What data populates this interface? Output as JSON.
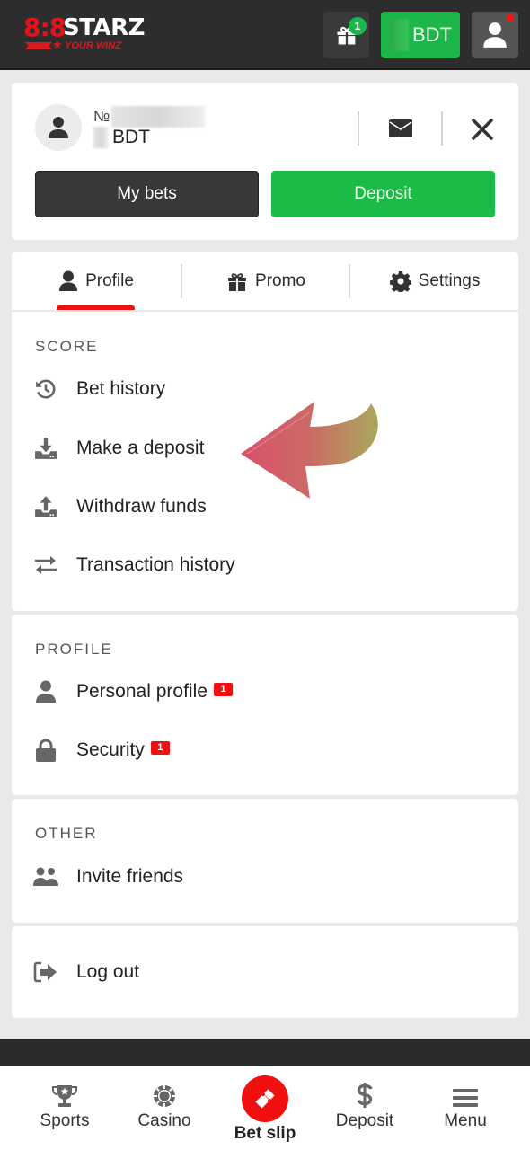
{
  "header": {
    "logo": {
      "digits": "8:8",
      "brand": "STARZ",
      "tagline": "YOUR WINZ"
    },
    "gift_badge": "1",
    "balance_currency": "BDT",
    "user_notification": true
  },
  "account": {
    "number_prefix": "№",
    "currency": "BDT",
    "my_bets_label": "My bets",
    "deposit_label": "Deposit"
  },
  "tabs": [
    {
      "label": "Profile",
      "icon": "user-icon",
      "active": true
    },
    {
      "label": "Promo",
      "icon": "gift-icon",
      "active": false
    },
    {
      "label": "Settings",
      "icon": "gear-icon",
      "active": false
    }
  ],
  "sections": {
    "score": {
      "title": "SCORE",
      "items": [
        {
          "label": "Bet history",
          "icon": "history-icon"
        },
        {
          "label": "Make a deposit",
          "icon": "download-tray-icon"
        },
        {
          "label": "Withdraw funds",
          "icon": "upload-tray-icon"
        },
        {
          "label": "Transaction history",
          "icon": "swap-arrows-icon"
        }
      ]
    },
    "profile": {
      "title": "PROFILE",
      "items": [
        {
          "label": "Personal profile",
          "icon": "person-icon",
          "badge": "1"
        },
        {
          "label": "Security",
          "icon": "lock-icon",
          "badge": "1"
        }
      ]
    },
    "other": {
      "title": "OTHER",
      "items": [
        {
          "label": "Invite friends",
          "icon": "users-icon"
        }
      ]
    },
    "logout": {
      "items": [
        {
          "label": "Log out",
          "icon": "logout-icon"
        }
      ]
    }
  },
  "bottom_nav": [
    {
      "label": "Sports",
      "icon": "trophy-icon"
    },
    {
      "label": "Casino",
      "icon": "casino-chip-icon"
    },
    {
      "label": "Bet slip",
      "icon": "ticket-icon"
    },
    {
      "label": "Deposit",
      "icon": "dollar-icon"
    },
    {
      "label": "Menu",
      "icon": "hamburger-icon"
    }
  ],
  "colors": {
    "accent_red": "#f01010",
    "accent_green": "#1bbb47",
    "header_bg": "#2d2d2d"
  }
}
